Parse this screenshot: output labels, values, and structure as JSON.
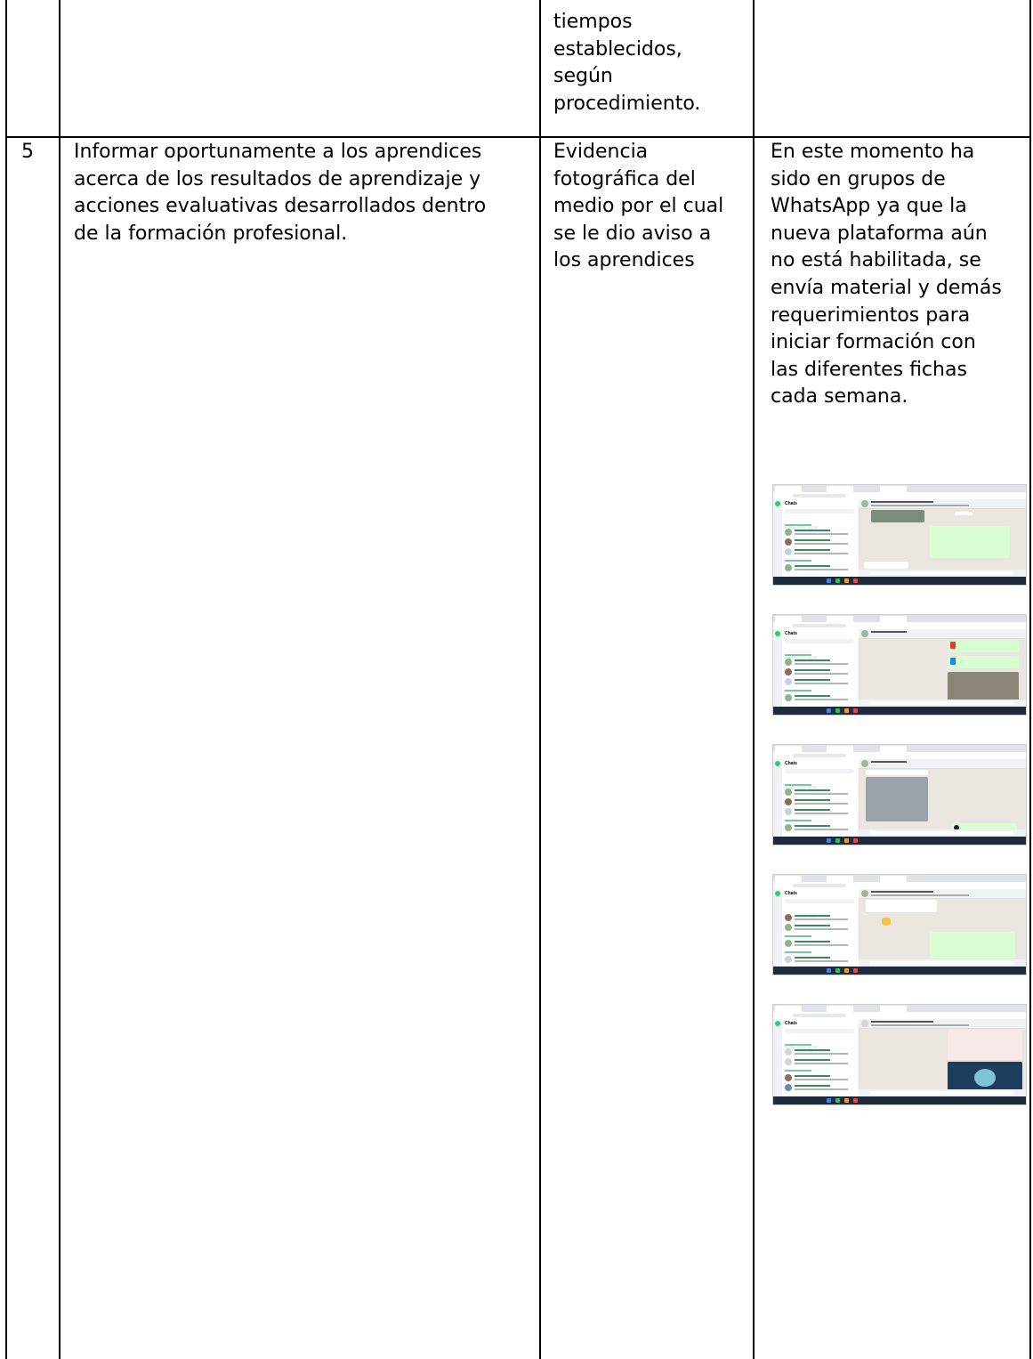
{
  "table": {
    "row_prev": {
      "evidence": "tiempos\nestablecidos,\nsegún\nprocedimiento."
    },
    "row_5": {
      "number": "5",
      "activity": "Informar oportunamente a los aprendices\nacerca de los resultados de aprendizaje y\nacciones evaluativas desarrollados dentro\nde la formación profesional.",
      "evidence": "Evidencia\nfotográfica del\nmedio por el cual\nse le dio aviso a\nlos aprendices",
      "observation": "En este momento ha\nsido en grupos de\nWhatsApp ya que la\nnueva plataforma aún\nno está habilitada, se\nenvía material y demás\nrequerimientos para\niniciar formación con\nlas diferentes fichas\ncada semana."
    }
  },
  "screenshots": {
    "app_title": "Chats",
    "count": 5,
    "colors": {
      "outgoing_bubble": "#d9fdd3",
      "chat_background": "#ebe6df",
      "accent": "#25d366",
      "taskbar": "#1f2a3a"
    },
    "icons": [
      "whatsapp-icon",
      "pdf-file-icon",
      "doc-file-icon",
      "thumbs-up-icon",
      "audio-play-icon"
    ]
  }
}
